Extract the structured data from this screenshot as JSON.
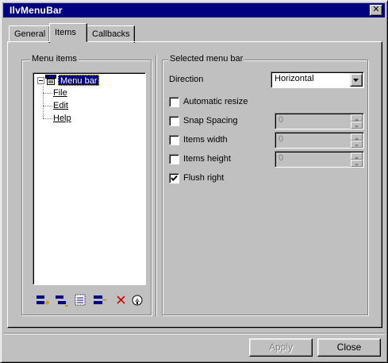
{
  "window": {
    "title": "IlvMenuBar",
    "close_glyph": "✕"
  },
  "tabs": [
    {
      "label": "General",
      "active": false
    },
    {
      "label": "Items",
      "active": true
    },
    {
      "label": "Callbacks",
      "active": false
    }
  ],
  "menu_items": {
    "group_label": "Menu items",
    "tree": {
      "root": {
        "label": "Menu bar",
        "icon": "menubar-icon",
        "selected": true
      },
      "children": [
        {
          "label": "File"
        },
        {
          "label": "Edit"
        },
        {
          "label": "Help"
        }
      ]
    },
    "toolbar": [
      {
        "name": "add-item-button",
        "icon": "add-item-icon"
      },
      {
        "name": "add-subitem-button",
        "icon": "add-subitem-icon"
      },
      {
        "name": "add-separator-button",
        "icon": "add-separator-icon"
      },
      {
        "name": "insert-item-button",
        "icon": "insert-item-icon"
      },
      {
        "name": "delete-button",
        "icon": "delete-icon"
      },
      {
        "name": "properties-button",
        "icon": "properties-icon"
      }
    ]
  },
  "selected": {
    "group_label": "Selected menu bar",
    "direction": {
      "label": "Direction",
      "value": "Horizontal"
    },
    "automatic_resize": {
      "label": "Automatic resize",
      "checked": false
    },
    "snap_spacing": {
      "label": "Snap Spacing",
      "checked": false,
      "value": "0",
      "enabled": false
    },
    "items_width": {
      "label": "Items width",
      "checked": false,
      "value": "0",
      "enabled": false
    },
    "items_height": {
      "label": "Items height",
      "checked": false,
      "value": "0",
      "enabled": false
    },
    "flush_right": {
      "label": "Flush right",
      "checked": true
    }
  },
  "footer": {
    "apply_label": "Apply",
    "apply_enabled": false,
    "close_label": "Close"
  },
  "colors": {
    "face": "#c0c0c0",
    "title_bar": "#000080",
    "selection": "#000080",
    "disabled_text": "#808080"
  }
}
